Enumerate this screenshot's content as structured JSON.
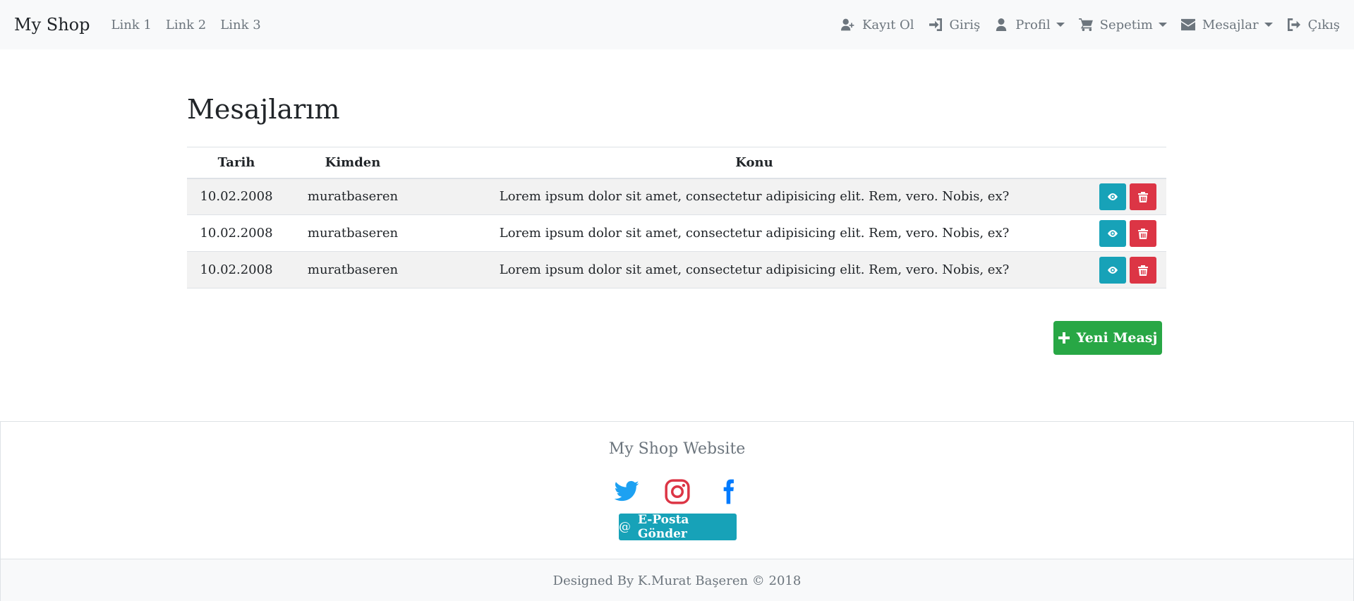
{
  "navbar": {
    "brand": "My Shop",
    "links": [
      "Link 1",
      "Link 2",
      "Link 3"
    ],
    "right": {
      "register": "Kayıt Ol",
      "login": "Giriş",
      "profile": "Profil",
      "cart": "Sepetim",
      "messages": "Mesajlar",
      "logout": "Çıkış"
    }
  },
  "main": {
    "title": "Mesajlarım",
    "table": {
      "headers": [
        "Tarih",
        "Kimden",
        "Konu"
      ],
      "rows": [
        {
          "date": "10.02.2008",
          "from": "muratbaseren",
          "subject": "Lorem ipsum dolor sit amet, consectetur adipisicing elit. Rem, vero. Nobis, ex?"
        },
        {
          "date": "10.02.2008",
          "from": "muratbaseren",
          "subject": "Lorem ipsum dolor sit amet, consectetur adipisicing elit. Rem, vero. Nobis, ex?"
        },
        {
          "date": "10.02.2008",
          "from": "muratbaseren",
          "subject": "Lorem ipsum dolor sit amet, consectetur adipisicing elit. Rem, vero. Nobis, ex?"
        }
      ]
    },
    "new_message": "Yeni Measj"
  },
  "footer": {
    "title": "My Shop Website",
    "social": [
      "twitter-icon",
      "instagram-icon",
      "facebook-icon"
    ],
    "mail_button": "E-Posta Gönder",
    "copyright": "Designed By K.Murat Başeren © 2018"
  },
  "colors": {
    "info": "#17a2b8",
    "danger": "#dc3545",
    "success": "#28a745",
    "twitter": "#1da1f2",
    "instagram": "#dc3545",
    "facebook": "#007bff"
  }
}
